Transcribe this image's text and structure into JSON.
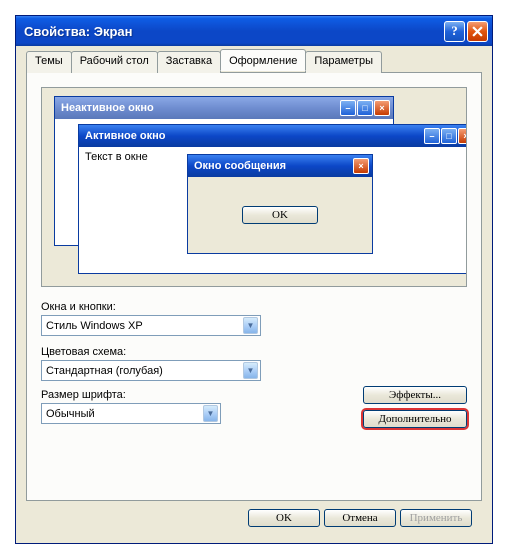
{
  "window": {
    "title": "Свойства: Экран"
  },
  "tabs": {
    "themes": "Темы",
    "desktop": "Рабочий стол",
    "screensaver": "Заставка",
    "appearance": "Оформление",
    "settings": "Параметры"
  },
  "preview": {
    "inactive_title": "Неактивное окно",
    "active_title": "Активное окно",
    "window_text": "Текст в окне",
    "msg_title": "Окно сообщения",
    "msg_ok": "OK"
  },
  "labels": {
    "windows_buttons": "Окна и кнопки:",
    "color_scheme": "Цветовая схема:",
    "font_size": "Размер шрифта:"
  },
  "selects": {
    "windows_buttons": "Стиль Windows XP",
    "color_scheme": "Стандартная (голубая)",
    "font_size": "Обычный"
  },
  "buttons": {
    "effects": "Эффекты...",
    "advanced": "Дополнительно",
    "ok": "OK",
    "cancel": "Отмена",
    "apply": "Применить"
  }
}
